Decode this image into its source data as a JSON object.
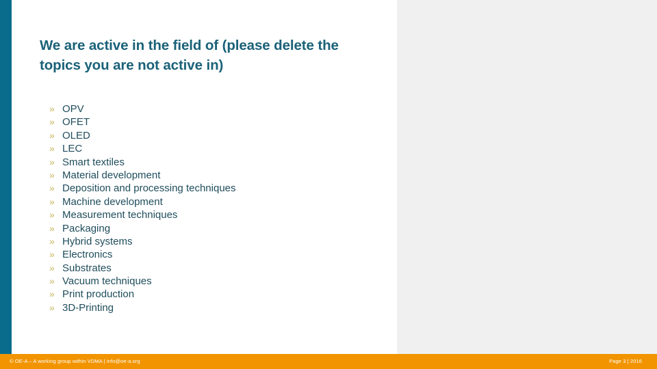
{
  "slide": {
    "title": "We are active in the field of (please delete the topics you are not active in)",
    "accent_color": "#0a6c8c",
    "title_color": "#1a6178",
    "bullet_marker_color": "#c5b45e",
    "bullet_text_color": "#1f4d5c",
    "footer_color": "#f29400",
    "panel_color": "#ffffff",
    "background_color": "#f0f0f0"
  },
  "bullets": {
    "marker": "»",
    "items": [
      {
        "label": "OPV"
      },
      {
        "label": "OFET"
      },
      {
        "label": "OLED"
      },
      {
        "label": "LEC"
      },
      {
        "label": "Smart textiles"
      },
      {
        "label": "Material development"
      },
      {
        "label": "Deposition and processing techniques"
      },
      {
        "label": "Machine development"
      },
      {
        "label": "Measurement techniques"
      },
      {
        "label": "Packaging"
      },
      {
        "label": "Hybrid systems"
      },
      {
        "label": "Electronics"
      },
      {
        "label": "Substrates"
      },
      {
        "label": "Vacuum techniques"
      },
      {
        "label": "Print production"
      },
      {
        "label": "3D-Printing"
      }
    ]
  },
  "footer": {
    "left_text": "© OE-A – A working group within VDMA | info@oe-a.org",
    "right_text": "Page 3 | 2016"
  }
}
